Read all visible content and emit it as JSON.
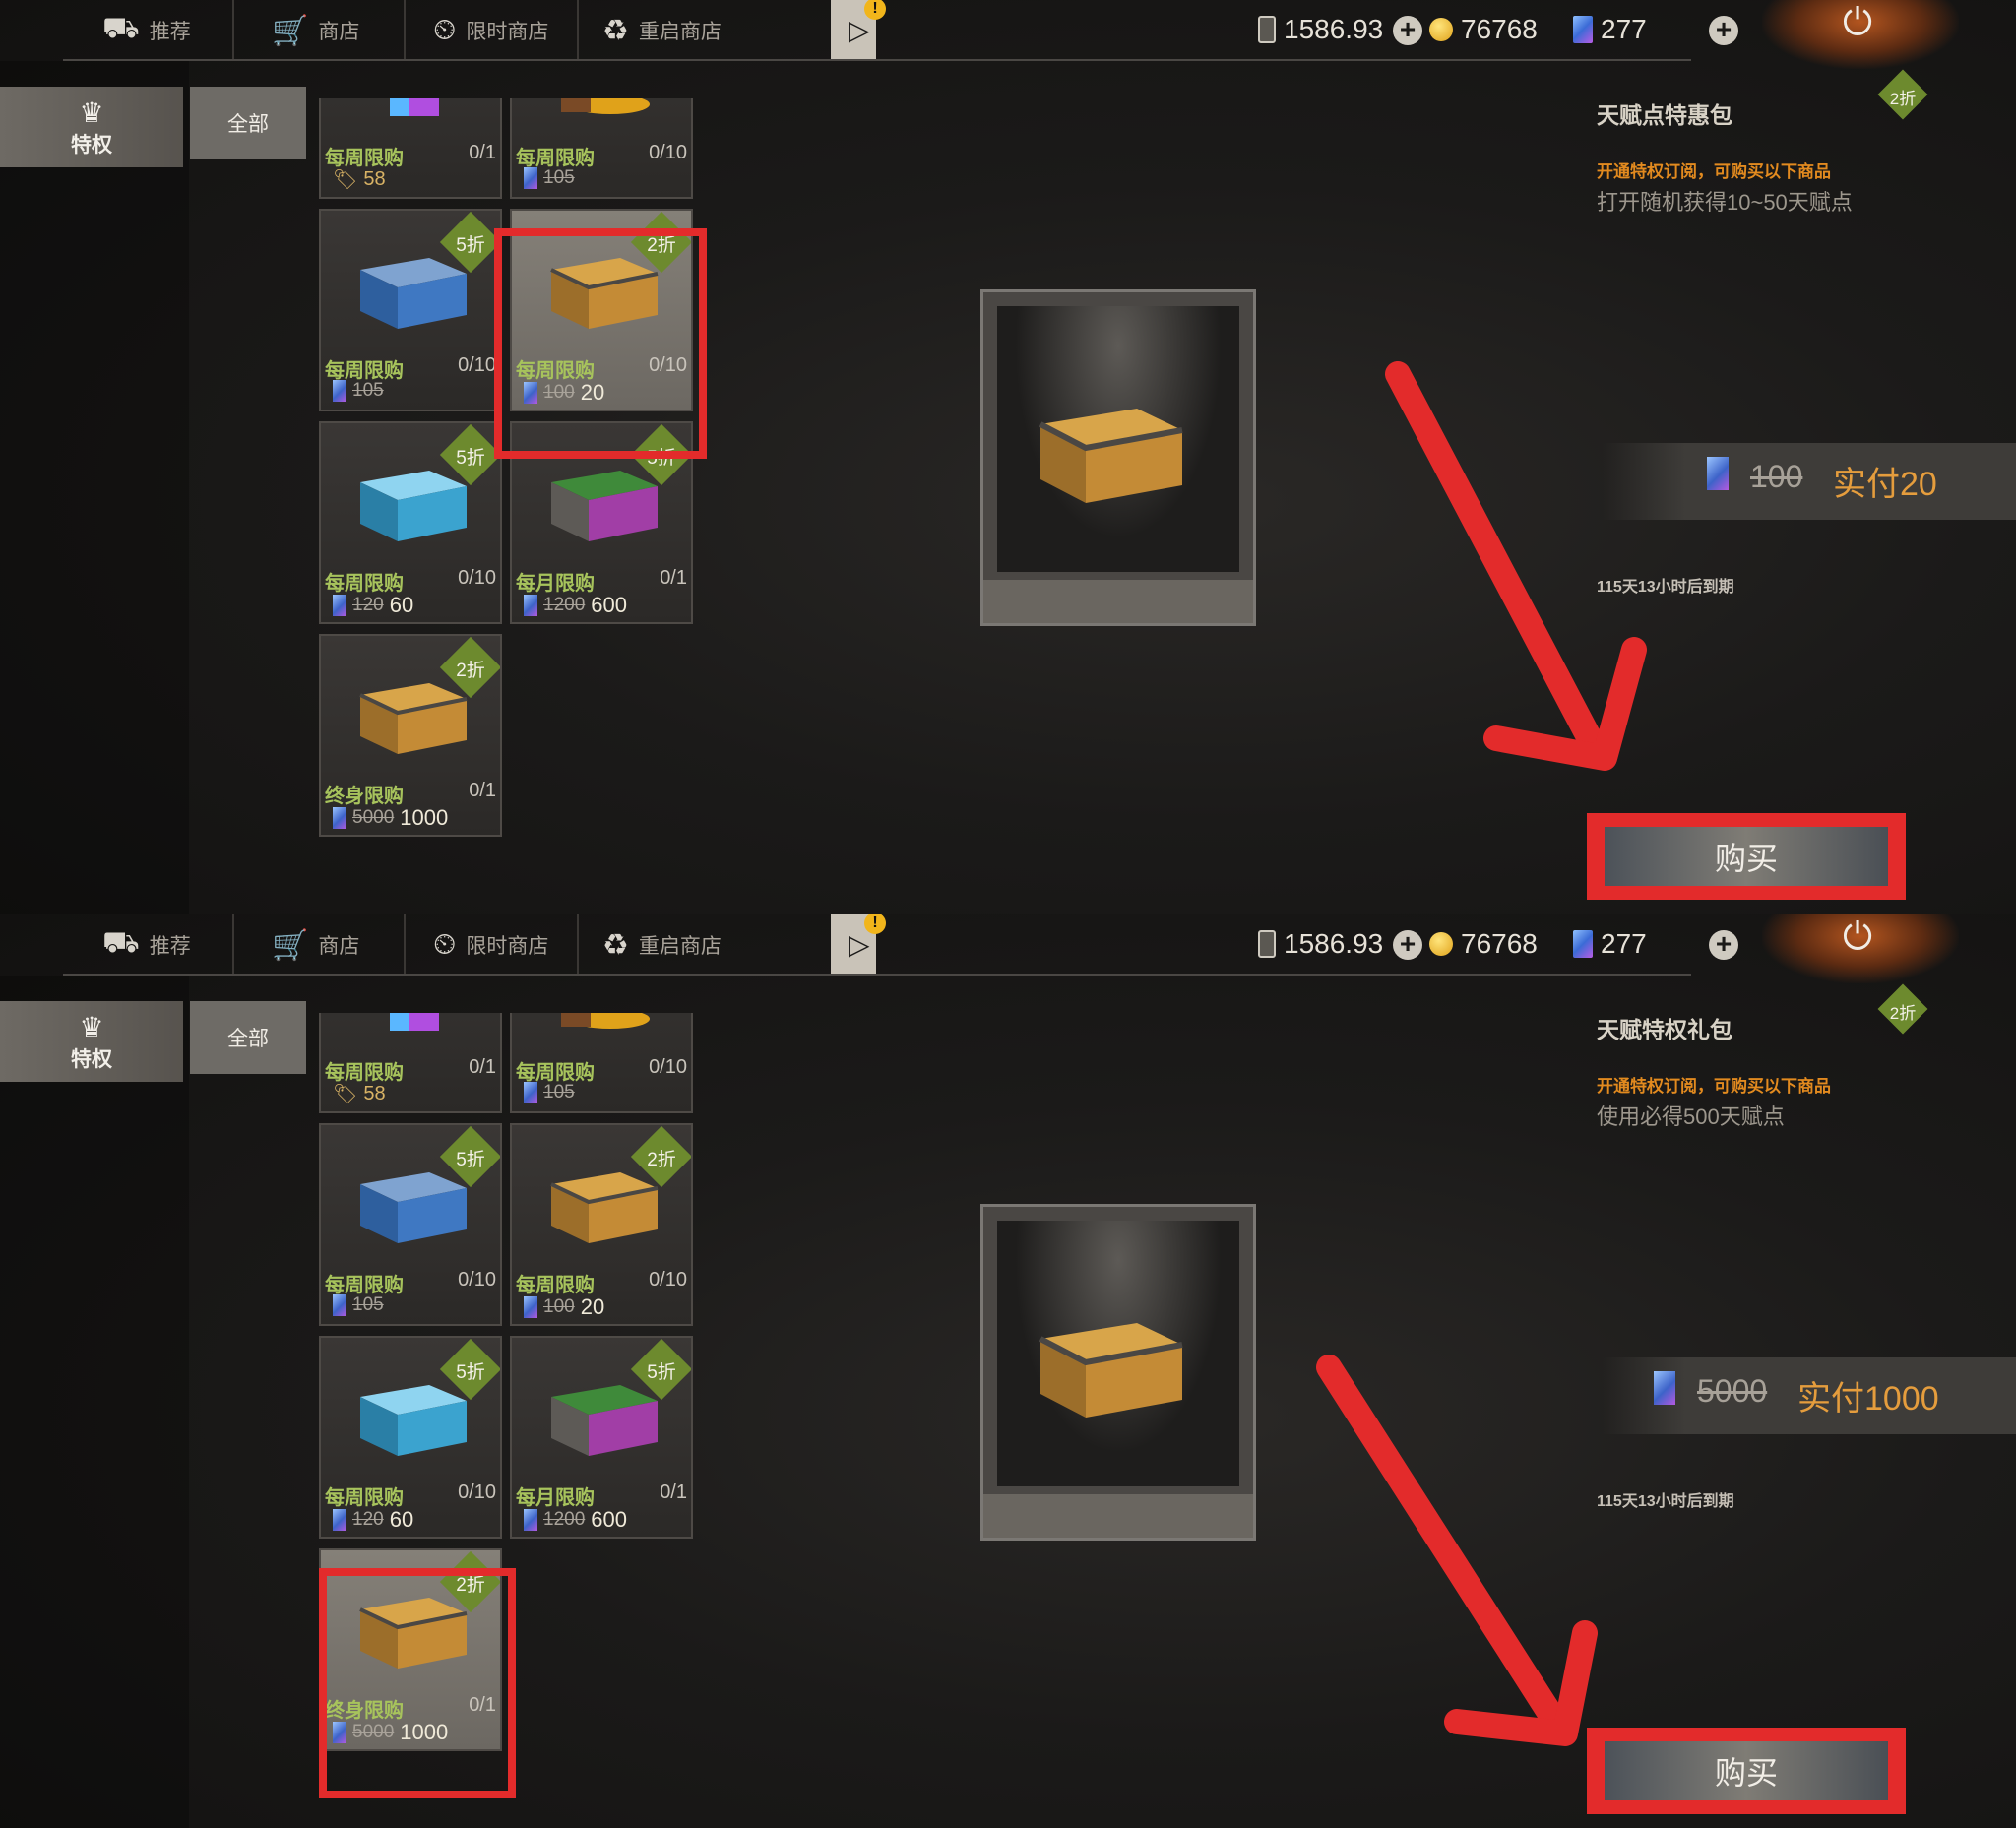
{
  "nav": {
    "tabs": [
      {
        "label": "推荐",
        "icon": "recommend-icon"
      },
      {
        "label": "商店",
        "icon": "cart-icon"
      },
      {
        "label": "限时商店",
        "icon": "clock-icon"
      },
      {
        "label": "重启商店",
        "icon": "restart-icon"
      }
    ],
    "balance_phone": "1586.93",
    "balance_coin": "76768",
    "balance_card": "277"
  },
  "sidebar": {
    "privilege_label": "特权",
    "all_label": "全部"
  },
  "items": [
    {
      "limit": "每周限购",
      "count": "0/1",
      "price_tag": "58"
    },
    {
      "limit": "每周限购",
      "count": "0/10",
      "old_price": "105",
      "new_price": ""
    },
    {
      "limit": "每周限购",
      "count": "0/10",
      "old_price": "105",
      "new_price": "",
      "discount": "5折"
    },
    {
      "limit": "每周限购",
      "count": "0/10",
      "old_price": "100",
      "new_price": "20",
      "discount": "2折"
    },
    {
      "limit": "每周限购",
      "count": "0/10",
      "old_price": "120",
      "new_price": "60",
      "discount": "5折"
    },
    {
      "limit": "每月限购",
      "count": "0/1",
      "old_price": "1200",
      "new_price": "600",
      "discount": "5折"
    },
    {
      "limit": "终身限购",
      "count": "0/1",
      "old_price": "5000",
      "new_price": "1000",
      "discount": "2折"
    }
  ],
  "panels": [
    {
      "title": "天赋点特惠包",
      "discount": "2折",
      "subscribe_note": "开通特权订阅，可购买以下商品",
      "description": "打开随机获得10~50天赋点",
      "old_price": "100",
      "paid_price": "实付20",
      "expire": "115天13小时后到期",
      "buy_label": "购买"
    },
    {
      "title": "天赋特权礼包",
      "discount": "2折",
      "subscribe_note": "开通特权订阅，可购买以下商品",
      "description": "使用必得500天赋点",
      "old_price": "5000",
      "paid_price": "实付1000",
      "expire": "115天13小时后到期",
      "buy_label": "购买"
    }
  ],
  "colors": {
    "highlight": "#e32b2b",
    "discount_badge": "#6d8a2e",
    "limit_text": "#a7c35c",
    "paid_text": "#e59d3d"
  }
}
